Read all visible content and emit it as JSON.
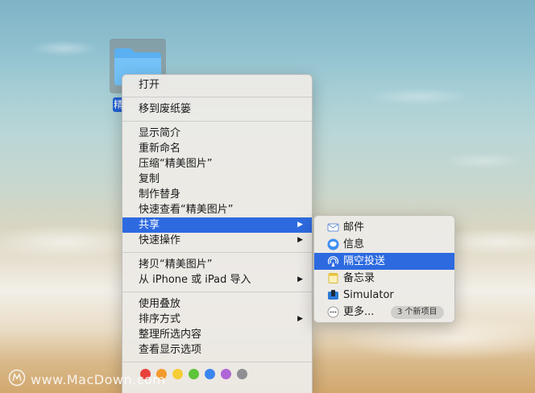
{
  "desktop": {
    "folder_label": "精"
  },
  "menu": {
    "groups": [
      [
        {
          "label": "打开"
        }
      ],
      [
        {
          "label": "移到废纸篓"
        }
      ],
      [
        {
          "label": "显示简介"
        },
        {
          "label": "重新命名"
        },
        {
          "label": "压缩“精美图片”"
        },
        {
          "label": "复制"
        },
        {
          "label": "制作替身"
        },
        {
          "label": "快速查看“精美图片”"
        },
        {
          "label": "共享"
        },
        {
          "label": "快速操作"
        }
      ],
      [
        {
          "label": "拷贝“精美图片”"
        },
        {
          "label": "从 iPhone 或 iPad 导入"
        }
      ],
      [
        {
          "label": "使用叠放"
        },
        {
          "label": "排序方式"
        },
        {
          "label": "整理所选内容"
        },
        {
          "label": "查看显示选项"
        }
      ]
    ],
    "submenu_arrow": "▶",
    "tag_colors": [
      "#e8413b",
      "#f39a2c",
      "#f5cd37",
      "#5ec43a",
      "#3a86f0",
      "#b065d6",
      "#8e8e93"
    ]
  },
  "share_submenu": {
    "items": [
      {
        "label": "邮件",
        "icon": "mail-icon"
      },
      {
        "label": "信息",
        "icon": "messages-icon"
      },
      {
        "label": "隔空投送",
        "icon": "airdrop-icon"
      },
      {
        "label": "备忘录",
        "icon": "notes-icon"
      },
      {
        "label": "Simulator",
        "icon": "simulator-icon"
      },
      {
        "label": "更多...",
        "icon": "more-icon"
      }
    ],
    "badge": "3 个新项目"
  },
  "watermark": {
    "text": "www.MacDown.com"
  }
}
